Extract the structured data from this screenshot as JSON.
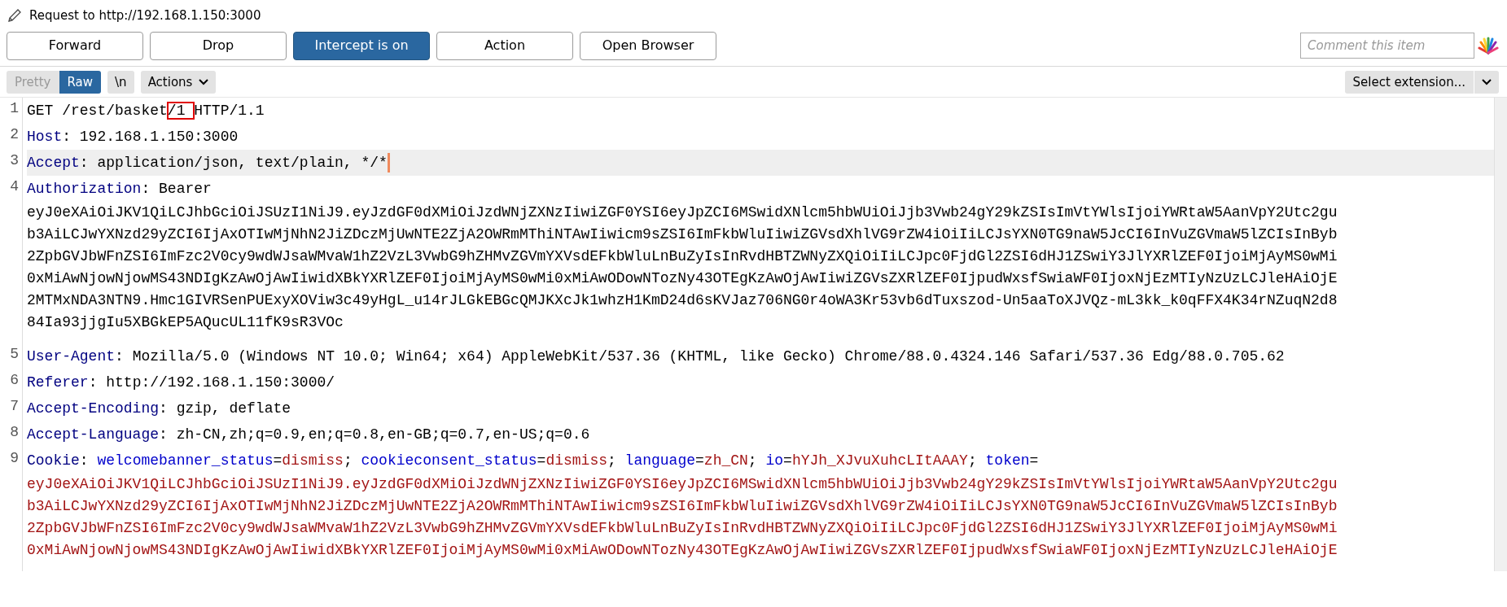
{
  "title": "Request to http://192.168.1.150:3000",
  "buttons": [
    {
      "label": "Forward",
      "on": false
    },
    {
      "label": "Drop",
      "on": false
    },
    {
      "label": "Intercept is on",
      "on": true
    },
    {
      "label": "Action",
      "on": false
    },
    {
      "label": "Open Browser",
      "on": false
    }
  ],
  "comment": {
    "placeholder": "Comment this item"
  },
  "view_tabs": [
    {
      "label": "Pretty",
      "selected": false
    },
    {
      "label": "Raw",
      "selected": true
    }
  ],
  "newline_toggle": {
    "label": "\\n",
    "on": false
  },
  "actions_menu": {
    "label": "Actions"
  },
  "extension_select": {
    "label": "Select extension..."
  },
  "lines": [
    {
      "number": "1",
      "current": false,
      "parts": [
        {
          "kind": "text",
          "text": "GET /rest/basket",
          "highlighted": false
        },
        {
          "kind": "text",
          "text": "/1 ",
          "highlighted": true
        },
        {
          "kind": "text",
          "text": "HTTP/1.1",
          "highlighted": false
        }
      ]
    },
    {
      "number": "2",
      "current": false,
      "parts": [
        {
          "kind": "name",
          "text": "Host",
          "highlighted": false
        },
        {
          "kind": "text",
          "text": ": 192.168.1.150:3000",
          "highlighted": false
        }
      ]
    },
    {
      "number": "3",
      "current": true,
      "parts": [
        {
          "kind": "name",
          "text": "Accept",
          "highlighted": false
        },
        {
          "kind": "text",
          "text": ": application/json, text/plain, */*",
          "highlighted": false
        }
      ]
    },
    {
      "number": "4",
      "current": false,
      "parts": [
        {
          "kind": "name",
          "text": "Authorization",
          "highlighted": false
        },
        {
          "kind": "text",
          "text": ": Bearer",
          "highlighted": false
        }
      ],
      "wrap": {
        "kind": "text",
        "lines": [
          "eyJ0eXAiOiJKV1QiLCJhbGciOiJSUzI1NiJ9.eyJzdGF0dXMiOiJzdWNjZXNzIiwiZGF0YSI6eyJpZCI6MSwidXNlcm5hbWUiOiJjb3Vwb24gY29kZSIsImVtYWlsIjoiYWRtaW5AanVpY2Utc2gu",
          "b3AiLCJwYXNzd29yZCI6IjAxOTIwMjNhN2JiZDczMjUwNTE2ZjA2OWRmMThiNTAwIiwicm9sZSI6ImFkbWluIiwiZGVsdXhlVG9rZW4iOiIiLCJsYXN0TG9naW5JcCI6InVuZGVmaW5lZCIsInByb",
          "2ZpbGVJbWFnZSI6ImFzc2V0cy9wdWJsaWMvaW1hZ2VzL3VwbG9hZHMvZGVmYXVsdEFkbWluLnBuZyIsInRvdHBTZWNyZXQiOiIiLCJpc0FjdGl2ZSI6dHJ1ZSwiY3JlYXRlZEF0IjoiMjAyMS0wMi",
          "0xMiAwNjowNjowMS43NDIgKzAwOjAwIiwidXBkYXRlZEF0IjoiMjAyMS0wMi0xMiAwODowNTozNy43OTEgKzAwOjAwIiwiZGVsZXRlZEF0IjpudWxsfSwiaWF0IjoxNjEzMTIyNzUzLCJleHAiOjE",
          "2MTMxNDA3NTN9.Hmc1GIVRSenPUExyXOViw3c49yHgL_u14rJLGkEBGcQMJKXcJk1whzH1KmD24d6sKVJaz706NG0r4oWA3Kr53vb6dTuxszod-Un5aaToXJVQz-mL3kk_k0qFFX4K34rNZuqN2d8",
          "84Ia93jjgIu5XBGkEP5AQucUL11fK9sR3VOc"
        ]
      }
    },
    {
      "number": "5",
      "current": false,
      "parts": [
        {
          "kind": "name",
          "text": "User-Agent",
          "highlighted": false
        },
        {
          "kind": "text",
          "text": ": Mozilla/5.0 (Windows NT 10.0; Win64; x64) AppleWebKit/537.36 (KHTML, like Gecko) Chrome/88.0.4324.146 Safari/537.36 Edg/88.0.705.62",
          "highlighted": false
        }
      ]
    },
    {
      "number": "6",
      "current": false,
      "parts": [
        {
          "kind": "name",
          "text": "Referer",
          "highlighted": false
        },
        {
          "kind": "text",
          "text": ": http://192.168.1.150:3000/",
          "highlighted": false
        }
      ]
    },
    {
      "number": "7",
      "current": false,
      "parts": [
        {
          "kind": "name",
          "text": "Accept-Encoding",
          "highlighted": false
        },
        {
          "kind": "text",
          "text": ": gzip, deflate",
          "highlighted": false
        }
      ]
    },
    {
      "number": "8",
      "current": false,
      "parts": [
        {
          "kind": "name",
          "text": "Accept-Language",
          "highlighted": false
        },
        {
          "kind": "text",
          "text": ": zh-CN,zh;q=0.9,en;q=0.8,en-GB;q=0.7,en-US;q=0.6",
          "highlighted": false
        }
      ]
    },
    {
      "number": "9",
      "current": false,
      "parts": [
        {
          "kind": "name",
          "text": "Cookie",
          "highlighted": false
        },
        {
          "kind": "text",
          "text": ": ",
          "highlighted": false
        },
        {
          "kind": "cookie_name",
          "text": "welcomebanner_status",
          "highlighted": false
        },
        {
          "kind": "text",
          "text": "=",
          "highlighted": false
        },
        {
          "kind": "cookie_value",
          "text": "dismiss",
          "highlighted": false
        },
        {
          "kind": "text",
          "text": "; ",
          "highlighted": false
        },
        {
          "kind": "cookie_name",
          "text": "cookieconsent_status",
          "highlighted": false
        },
        {
          "kind": "text",
          "text": "=",
          "highlighted": false
        },
        {
          "kind": "cookie_value",
          "text": "dismiss",
          "highlighted": false
        },
        {
          "kind": "text",
          "text": "; ",
          "highlighted": false
        },
        {
          "kind": "cookie_name",
          "text": "language",
          "highlighted": false
        },
        {
          "kind": "text",
          "text": "=",
          "highlighted": false
        },
        {
          "kind": "cookie_value",
          "text": "zh_CN",
          "highlighted": false
        },
        {
          "kind": "text",
          "text": "; ",
          "highlighted": false
        },
        {
          "kind": "cookie_name",
          "text": "io",
          "highlighted": false
        },
        {
          "kind": "text",
          "text": "=",
          "highlighted": false
        },
        {
          "kind": "cookie_value",
          "text": "hYJh_XJvuXuhcLItAAAY",
          "highlighted": false
        },
        {
          "kind": "text",
          "text": "; ",
          "highlighted": false
        },
        {
          "kind": "cookie_name",
          "text": "token",
          "highlighted": false
        },
        {
          "kind": "text",
          "text": "=",
          "highlighted": false
        }
      ],
      "wrap": {
        "kind": "cookie_value",
        "lines": [
          "eyJ0eXAiOiJKV1QiLCJhbGciOiJSUzI1NiJ9.eyJzdGF0dXMiOiJzdWNjZXNzIiwiZGF0YSI6eyJpZCI6MSwidXNlcm5hbWUiOiJjb3Vwb24gY29kZSIsImVtYWlsIjoiYWRtaW5AanVpY2Utc2gu",
          "b3AiLCJwYXNzd29yZCI6IjAxOTIwMjNhN2JiZDczMjUwNTE2ZjA2OWRmMThiNTAwIiwicm9sZSI6ImFkbWluIiwiZGVsdXhlVG9rZW4iOiIiLCJsYXN0TG9naW5JcCI6InVuZGVmaW5lZCIsInByb",
          "2ZpbGVJbWFnZSI6ImFzc2V0cy9wdWJsaWMvaW1hZ2VzL3VwbG9hZHMvZGVmYXVsdEFkbWluLnBuZyIsInRvdHBTZWNyZXQiOiIiLCJpc0FjdGl2ZSI6dHJ1ZSwiY3JlYXRlZEF0IjoiMjAyMS0wMi",
          "0xMiAwNjowNjowMS43NDIgKzAwOjAwIiwidXBkYXRlZEF0IjoiMjAyMS0wMi0xMiAwODowNTozNy43OTEgKzAwOjAwIiwiZGVsZXRlZEF0IjpudWxsfSwiaWF0IjoxNjEzMTIyNzUzLCJleHAiOjE"
        ]
      }
    }
  ]
}
